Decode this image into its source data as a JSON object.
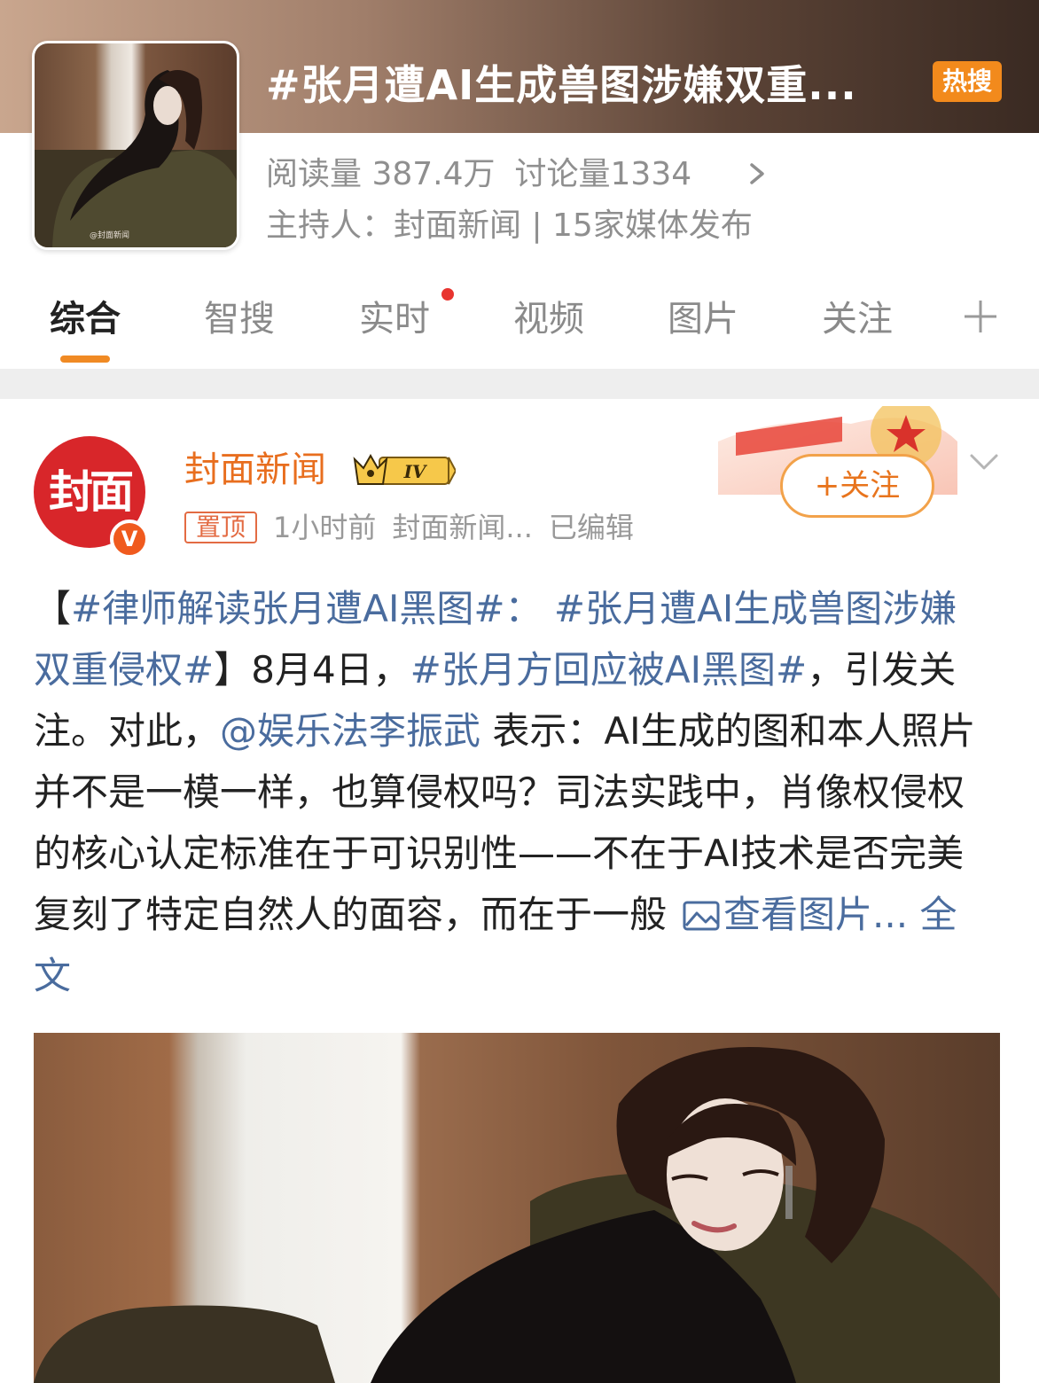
{
  "header": {
    "topic_title": "#张月遭AI生成兽图涉嫌双重...",
    "hot_badge": "热搜",
    "cover_watermark": "@封面新闻",
    "read_count": "阅读量 387.4万",
    "discuss_count": "讨论量1334",
    "host_line": "主持人：封面新闻 | 15家媒体发布"
  },
  "tabs": [
    {
      "label": "综合",
      "active": true
    },
    {
      "label": "智搜"
    },
    {
      "label": "实时",
      "has_dot": true
    },
    {
      "label": "视频"
    },
    {
      "label": "图片"
    },
    {
      "label": "关注"
    }
  ],
  "post": {
    "avatar_text": "封面",
    "verify_mark": "V",
    "author": "封面新闻",
    "level": "IV",
    "pin": "置顶",
    "time": "1小时前",
    "source": "封面新闻...",
    "edited": "已编辑",
    "follow_label": "+关注",
    "text": {
      "bracket_open": "【",
      "tag1": "#律师解读张月遭AI黑图#：",
      "tag2": "#张月遭AI生成兽图涉嫌双重侵权#",
      "bracket_close": "】",
      "seg1": "8月4日，",
      "tag3": "#张月方回应被AI黑图#",
      "seg2": "，引发关注。对此，",
      "mention": "@娱乐法李振武",
      "seg3": " 表示：AI生成的图和本人照片并不是一模一样，也算侵权吗？司法实践中，肖像权侵权的核心认定标准在于可识别性——不在于AI技术是否完美复刻了特定自然人的面容，而在于一般",
      "view_images": "查看图片...",
      "full_text": "全文"
    }
  },
  "colors": {
    "accent_orange": "#f08a24",
    "link_blue": "#4a6c9e",
    "author_orange": "#e86e1e",
    "avatar_red": "#d8262a",
    "hot_badge": "#f28a1c"
  },
  "icons": [
    "chevron-right-icon",
    "plus-icon",
    "level-crown-icon",
    "image-icon",
    "chevron-down-icon"
  ]
}
